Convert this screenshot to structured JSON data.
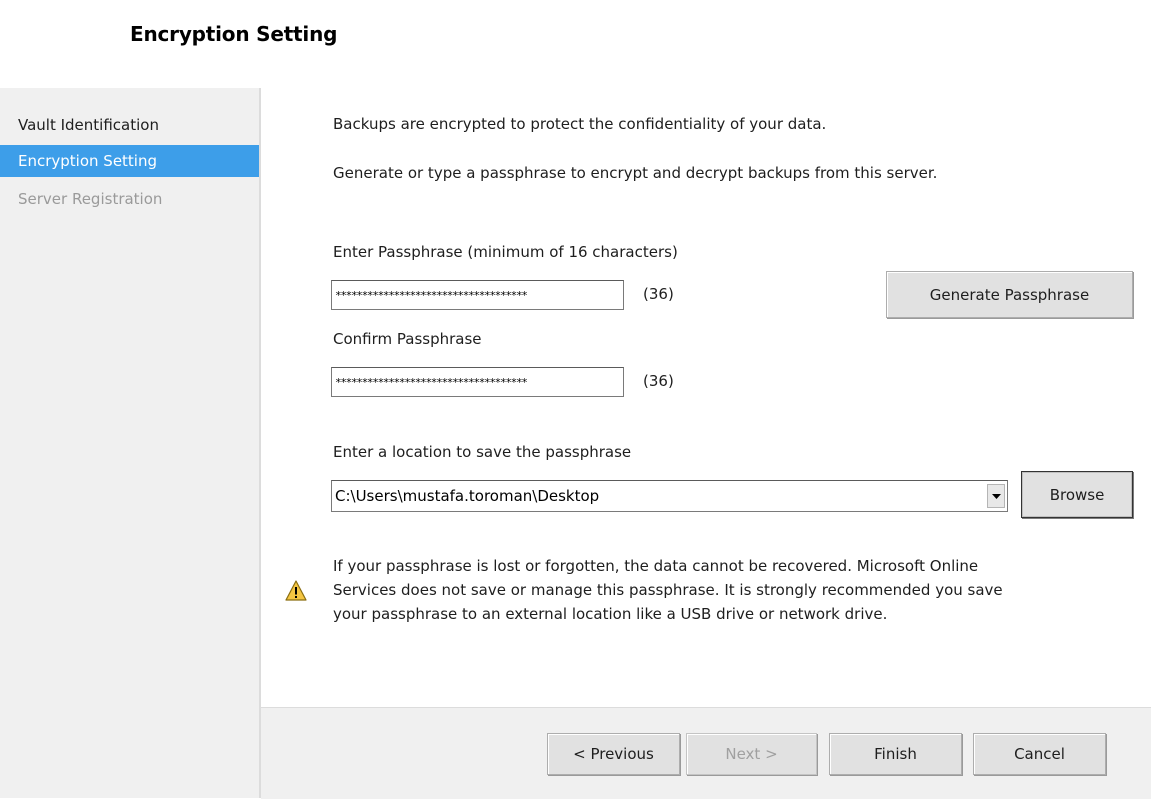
{
  "header": {
    "title": "Encryption Setting"
  },
  "sidebar": {
    "items": [
      {
        "label": "Vault Identification",
        "state": "normal"
      },
      {
        "label": "Encryption Setting",
        "state": "active"
      },
      {
        "label": "Server Registration",
        "state": "disabled"
      }
    ]
  },
  "intro": {
    "line1": "Backups are encrypted to protect the confidentiality of your data.",
    "line2": "Generate or type a passphrase to encrypt and decrypt backups from this server."
  },
  "passphrase": {
    "label": "Enter Passphrase (minimum of 16 characters)",
    "value": "************************************",
    "count": "(36)",
    "generate_label": "Generate Passphrase"
  },
  "confirm": {
    "label": "Confirm Passphrase",
    "value": "************************************",
    "count": "(36)"
  },
  "location": {
    "label": "Enter a location to save the passphrase",
    "value": "C:\\Users\\mustafa.toroman\\Desktop",
    "browse_label": "Browse"
  },
  "warning": {
    "icon": "warning-icon",
    "line1": "If your passphrase is lost or forgotten, the data cannot be recovered. Microsoft Online",
    "line2": "Services does not save or manage this passphrase. It is strongly recommended you save",
    "line3": "your passphrase to an external location like a USB drive or network drive."
  },
  "footer": {
    "previous_label": "< Previous",
    "next_label": "Next >",
    "finish_label": "Finish",
    "cancel_label": "Cancel"
  },
  "colors": {
    "accent": "#3d9ee9",
    "sidebar_bg": "#f0f0f0",
    "warning_yellow": "#f4c542"
  }
}
